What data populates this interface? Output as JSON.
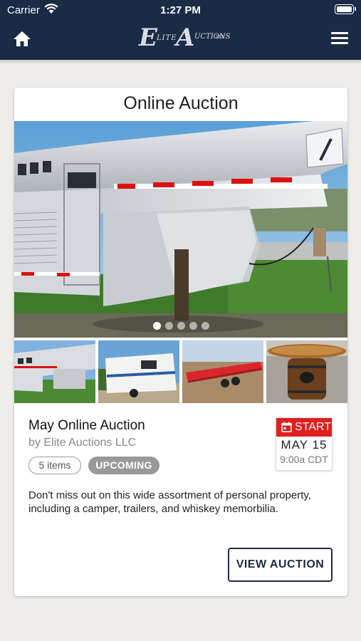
{
  "status_bar": {
    "carrier": "Carrier",
    "time": "1:27 PM"
  },
  "header": {
    "logo": {
      "initial1": "E",
      "word1": "LITE",
      "initial2": "A",
      "word2": "UCTIONS",
      "suffix": "LLC"
    }
  },
  "card": {
    "title": "Online Auction",
    "hero": {
      "slide_count": 5,
      "active_slide": 1
    },
    "thumbnails": [
      "trailer",
      "camper",
      "flatbed-trailer",
      "whiskey-barrel-table"
    ],
    "auction_name": "May Online Auction",
    "auction_by": "by Elite Auctions LLC",
    "items_badge": "5 items",
    "status_badge": "UPCOMING",
    "date": {
      "label": "START",
      "day": "MAY 15",
      "time": "9:00a CDT"
    },
    "description": "Don't miss out on this wide assortment of personal property, including a camper, trailers, and whiskey memorbilia.",
    "view_button": "VIEW AUCTION"
  },
  "colors": {
    "header_bg": "#1a2b45",
    "accent_red": "#e01e1e",
    "badge_gray": "#999999",
    "page_bg": "#eeedea"
  }
}
